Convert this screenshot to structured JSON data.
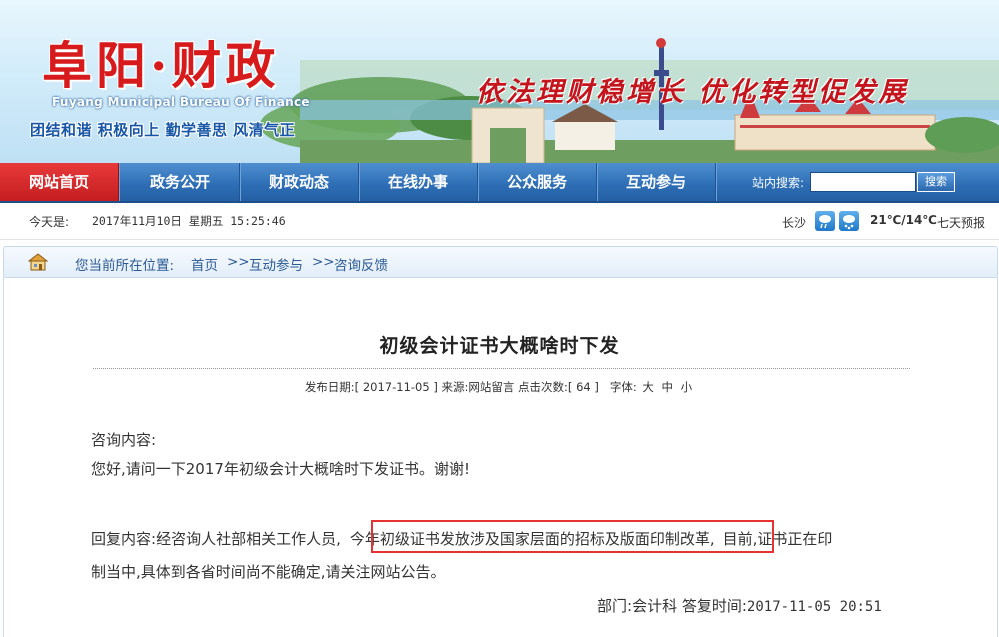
{
  "banner": {
    "title_cn": "阜阳·财政",
    "title_en": "Fuyang Municipal Bureau Of Finance",
    "motto": "团结和谐 积极向上 勤学善思 风清气正",
    "slogan": "依法理财稳增长 优化转型促发展"
  },
  "nav": {
    "items": [
      {
        "label": "网站首页",
        "active": true
      },
      {
        "label": "政务公开",
        "active": false
      },
      {
        "label": "财政动态",
        "active": false
      },
      {
        "label": "在线办事",
        "active": false
      },
      {
        "label": "公众服务",
        "active": false
      },
      {
        "label": "互动参与",
        "active": false
      }
    ],
    "search_label": "站内搜索:",
    "search_value": "",
    "search_button": "搜索"
  },
  "info": {
    "today_label": "今天是:",
    "today_value": "2017年11月10日 星期五 15:25:46",
    "city": "长沙",
    "weather_icons": [
      "rain-icon",
      "snow-icon"
    ],
    "temperature": "21℃/14℃",
    "forecast_link": "七天预报"
  },
  "breadcrumb": {
    "prefix": "您当前所在位置:",
    "items": [
      "首页",
      "互动参与",
      "咨询反馈"
    ],
    "separator": ">>"
  },
  "article": {
    "title": "初级会计证书大概啥时下发",
    "meta": {
      "date_label": "发布日期:[",
      "date": "2017-11-05",
      "source_label": "] 来源:",
      "source": "网站留言",
      "clicks_label": "点击次数:[",
      "clicks": "64",
      "clicks_end": "]",
      "font_label": "字体:",
      "font_sizes": [
        "大",
        "中",
        "小"
      ]
    },
    "question_label": "咨询内容:",
    "question": "您好,请问一下2017年初级会计大概啥时下发证书。谢谢!",
    "reply_label": "回复内容:",
    "reply_pre": "经咨询人社部相关工作人员,",
    "reply_highlight": "今年初级证书发放涉及国家层面的招标及版面印制改革,",
    "reply_post": "目前,证书正在印",
    "reply_line2": "制当中,具体到各省时间尚不能确定,请关注网站公告。",
    "dept_label": "部门:",
    "dept": "会计科",
    "reply_time_label": "答复时间:",
    "reply_time": "2017-11-05 20:51"
  },
  "colors": {
    "nav_blue": "#2f6fb6",
    "nav_active_red": "#c41e20",
    "highlight_red": "#e53333",
    "breadcrumb_blue": "#2b5a94"
  }
}
